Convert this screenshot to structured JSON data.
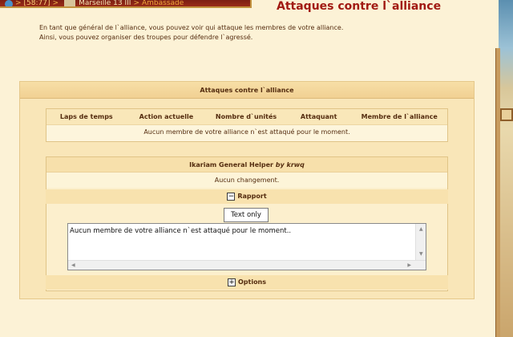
{
  "breadcrumb": {
    "coords": "[58:77]",
    "city": "Marseille 13 III",
    "current": "Ambassade"
  },
  "page": {
    "title": "Attaques contre l`alliance",
    "intro": "En tant que général de l`alliance, vous pouvez voir qui attaque les membres de votre alliance. Ainsi, vous pouvez organiser des troupes pour défendre l`agressé."
  },
  "panel": {
    "header": "Attaques contre l`alliance",
    "columns": [
      "Laps de temps",
      "Action actuelle",
      "Nombre d`unités",
      "Attaquant",
      "Membre de l`alliance"
    ],
    "empty_message": "Aucun membre de votre alliance n`est attaqué pour le moment."
  },
  "helper": {
    "title": "Ikariam General Helper",
    "by_label": "by krwq",
    "status": "Aucun changement.",
    "rapport_label": "Rapport",
    "rapport_toggle": "−",
    "text_only_button": "Text only",
    "report_text": "Aucun membre de votre alliance n`est attaqué pour le moment..",
    "options_label": "Options",
    "options_toggle": "+"
  },
  "icons": {
    "globe": "globe-icon",
    "city": "city-icon",
    "collapse": "collapse-icon",
    "expand": "expand-icon"
  },
  "colors": {
    "title_red": "#a11a12",
    "text_brown": "#542c0f",
    "panel_bg": "#f9e6b8"
  }
}
